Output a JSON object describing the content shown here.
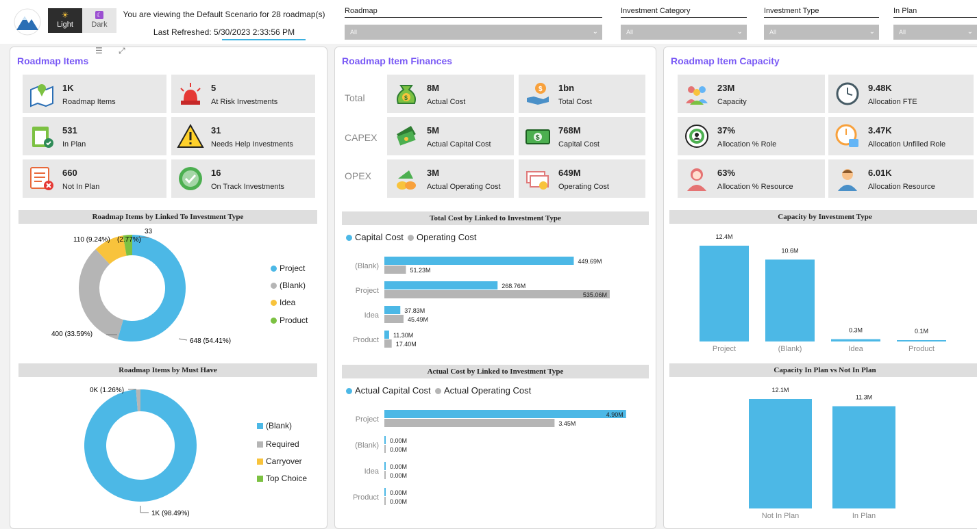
{
  "header": {
    "theme_light": "Light",
    "theme_dark": "Dark",
    "scenario_text": "You are viewing the Default Scenario for 28 roadmap(s)",
    "refresh_text": "Last Refreshed: 5/30/2023 2:33:56 PM"
  },
  "filters": [
    {
      "label": "Roadmap",
      "value": "All"
    },
    {
      "label": "Investment Category",
      "value": "All"
    },
    {
      "label": "Investment Type",
      "value": "All"
    },
    {
      "label": "In Plan",
      "value": "All"
    }
  ],
  "items_panel": {
    "title": "Roadmap Items",
    "cards": [
      {
        "value": "1K",
        "label": "Roadmap Items",
        "icon": "map-pin-icon"
      },
      {
        "value": "5",
        "label": "At Risk Investments",
        "icon": "alarm-siren-icon"
      },
      {
        "value": "531",
        "label": "In Plan",
        "icon": "clipboard-check-icon"
      },
      {
        "value": "31",
        "label": "Needs Help Investments",
        "icon": "warning-triangle-icon"
      },
      {
        "value": "660",
        "label": "Not In Plan",
        "icon": "list-x-icon"
      },
      {
        "value": "16",
        "label": "On Track Investments",
        "icon": "check-circle-icon"
      }
    ],
    "donut1_title": "Roadmap Items by Linked To Investment Type",
    "donut1_labels": [
      "33",
      "110 (9.24%)",
      "(2.77%)",
      "400 (33.59%)",
      "648 (54.41%)"
    ],
    "donut1_legend": [
      "Project",
      "(Blank)",
      "Idea",
      "Product"
    ],
    "donut2_title": "Roadmap Items by Must Have",
    "donut2_labels": [
      "0K (1.26%)",
      "1K (98.49%)"
    ],
    "donut2_legend": [
      "(Blank)",
      "Required",
      "Carryover",
      "Top Choice"
    ]
  },
  "finance_panel": {
    "title": "Roadmap Item Finances",
    "row_labels": [
      "Total",
      "CAPEX",
      "OPEX"
    ],
    "cards": [
      {
        "value": "8M",
        "label": "Actual Cost",
        "icon": "money-bag-icon"
      },
      {
        "value": "1bn",
        "label": "Total Cost",
        "icon": "hand-coin-icon"
      },
      {
        "value": "5M",
        "label": "Actual Capital Cost",
        "icon": "cash-stack-icon"
      },
      {
        "value": "768M",
        "label": "Capital Cost",
        "icon": "banknote-icon"
      },
      {
        "value": "3M",
        "label": "Actual Operating Cost",
        "icon": "coins-pile-icon"
      },
      {
        "value": "649M",
        "label": "Operating Cost",
        "icon": "bills-icon"
      }
    ],
    "bar1_title": "Total Cost by Linked to Investment Type",
    "bar1_legend": [
      "Capital Cost",
      "Operating Cost"
    ],
    "bar2_title": "Actual Cost by Linked to Investment Type",
    "bar2_legend": [
      "Actual Capital Cost",
      "Actual Operating Cost"
    ]
  },
  "capacity_panel": {
    "title": "Roadmap Item Capacity",
    "cards": [
      {
        "value": "23M",
        "label": "Capacity",
        "icon": "team-icon"
      },
      {
        "value": "9.48K",
        "label": "Allocation FTE",
        "icon": "clock-cycle-icon"
      },
      {
        "value": "37%",
        "label": "Allocation % Role",
        "icon": "target-person-icon"
      },
      {
        "value": "3.47K",
        "label": "Allocation Unfilled Role",
        "icon": "clock-lock-icon"
      },
      {
        "value": "63%",
        "label": "Allocation % Resource",
        "icon": "person-female-icon"
      },
      {
        "value": "6.01K",
        "label": "Allocation Resource",
        "icon": "person-male-icon"
      }
    ],
    "col1_title": "Capacity by Investment Type",
    "col2_title": "Capacity In Plan vs Not In Plan"
  },
  "colors": {
    "accent": "#7a5af5",
    "blue": "#4cb8e6",
    "gray": "#b5b5b5",
    "yellow": "#f8c33c",
    "green": "#7cc142"
  },
  "chart_data": [
    {
      "type": "pie",
      "title": "Roadmap Items by Linked To Investment Type",
      "categories": [
        "Project",
        "(Blank)",
        "Idea",
        "Product"
      ],
      "values": [
        648,
        400,
        110,
        33
      ],
      "percent": [
        54.41,
        33.59,
        9.24,
        2.77
      ]
    },
    {
      "type": "pie",
      "title": "Roadmap Items by Must Have",
      "categories": [
        "(Blank)",
        "Required",
        "Carryover",
        "Top Choice"
      ],
      "values": [
        98.49,
        1.26,
        0,
        0
      ],
      "data_labels": [
        "1K (98.49%)",
        "0K (1.26%)"
      ]
    },
    {
      "type": "bar",
      "orientation": "horizontal",
      "title": "Total Cost by Linked to Investment Type",
      "categories": [
        "(Blank)",
        "Project",
        "Idea",
        "Product"
      ],
      "series": [
        {
          "name": "Capital Cost",
          "values": [
            449.69,
            268.76,
            37.83,
            11.3
          ],
          "labels": [
            "449.69M",
            "268.76M",
            "37.83M",
            "11.30M"
          ]
        },
        {
          "name": "Operating Cost",
          "values": [
            51.23,
            535.06,
            45.49,
            17.4
          ],
          "labels": [
            "51.23M",
            "535.06M",
            "45.49M",
            "17.40M"
          ]
        }
      ]
    },
    {
      "type": "bar",
      "orientation": "horizontal",
      "title": "Actual Cost by Linked to Investment Type",
      "categories": [
        "Project",
        "(Blank)",
        "Idea",
        "Product"
      ],
      "series": [
        {
          "name": "Actual Capital Cost",
          "values": [
            4.9,
            0.0,
            0.0,
            0.0
          ],
          "labels": [
            "4.90M",
            "0.00M",
            "0.00M",
            "0.00M"
          ]
        },
        {
          "name": "Actual Operating Cost",
          "values": [
            3.45,
            0.0,
            0.0,
            0.0
          ],
          "labels": [
            "3.45M",
            "0.00M",
            "0.00M",
            "0.00M"
          ]
        }
      ]
    },
    {
      "type": "bar",
      "title": "Capacity by Investment Type",
      "categories": [
        "Project",
        "(Blank)",
        "Idea",
        "Product"
      ],
      "values": [
        12.4,
        10.6,
        0.3,
        0.1
      ],
      "labels": [
        "12.4M",
        "10.6M",
        "0.3M",
        "0.1M"
      ]
    },
    {
      "type": "bar",
      "title": "Capacity In Plan vs Not In Plan",
      "categories": [
        "Not In Plan",
        "In Plan"
      ],
      "values": [
        12.1,
        11.3
      ],
      "labels": [
        "12.1M",
        "11.3M"
      ]
    }
  ]
}
